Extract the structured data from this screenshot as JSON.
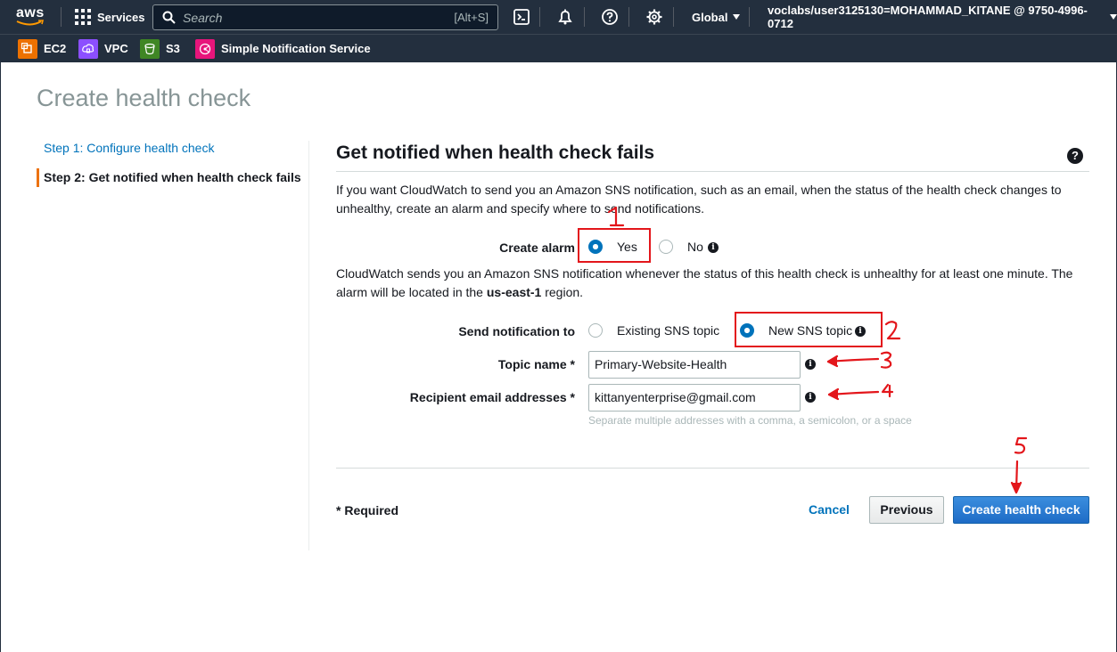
{
  "topnav": {
    "logo": "aws",
    "services_label": "Services",
    "search_placeholder": "Search",
    "search_shortcut": "[Alt+S]",
    "region_label": "Global",
    "account_label": "voclabs/user3125130=MOHAMMAD_KITANE @ 9750-4996-0712",
    "icons": [
      "cloudshell-icon",
      "notifications-bell-icon",
      "help-question-icon",
      "settings-gear-icon"
    ]
  },
  "favorites": [
    {
      "label": "EC2",
      "icon": "ec2-icon",
      "color": "#ed7100"
    },
    {
      "label": "VPC",
      "icon": "vpc-icon",
      "color": "#8c4fff"
    },
    {
      "label": "S3",
      "icon": "s3-icon",
      "color": "#3f8624"
    },
    {
      "label": "Simple Notification Service",
      "icon": "sns-icon",
      "color": "#e7157b"
    }
  ],
  "page": {
    "title": "Create health check",
    "steps": [
      {
        "label": "Step 1: Configure health check",
        "active": false
      },
      {
        "label": "Step 2: Get notified when health check fails",
        "active": true
      }
    ]
  },
  "section": {
    "title": "Get notified when health check fails",
    "description": "If you want CloudWatch to send you an Amazon SNS notification, such as an email, when the status of the health check changes to unhealthy, create an alarm and specify where to send notifications.",
    "alarm_note_prefix": "CloudWatch sends you an Amazon SNS notification whenever the status of this health check is unhealthy for at least one minute. The alarm will be located in the ",
    "alarm_note_region": "us-east-1",
    "alarm_note_suffix": " region."
  },
  "form": {
    "create_alarm_label": "Create alarm",
    "create_alarm_options": [
      {
        "label": "Yes",
        "selected": true
      },
      {
        "label": "No",
        "selected": false
      }
    ],
    "send_notification_label": "Send notification to",
    "send_notification_options": [
      {
        "label": "Existing SNS topic",
        "selected": false
      },
      {
        "label": "New SNS topic",
        "selected": true
      }
    ],
    "topic_name_label": "Topic name *",
    "topic_name_value": "Primary-Website-Health",
    "recipient_label": "Recipient email addresses *",
    "recipient_value": "kittanyenterprise@gmail.com",
    "recipient_hint": "Separate multiple addresses with a comma, a semicolon, or a space"
  },
  "footer": {
    "required_note": "* Required",
    "cancel_label": "Cancel",
    "previous_label": "Previous",
    "create_label": "Create health check"
  },
  "annotations": {
    "color": "#e3161b",
    "numbers": [
      "1",
      "2",
      "3",
      "4",
      "5"
    ]
  }
}
